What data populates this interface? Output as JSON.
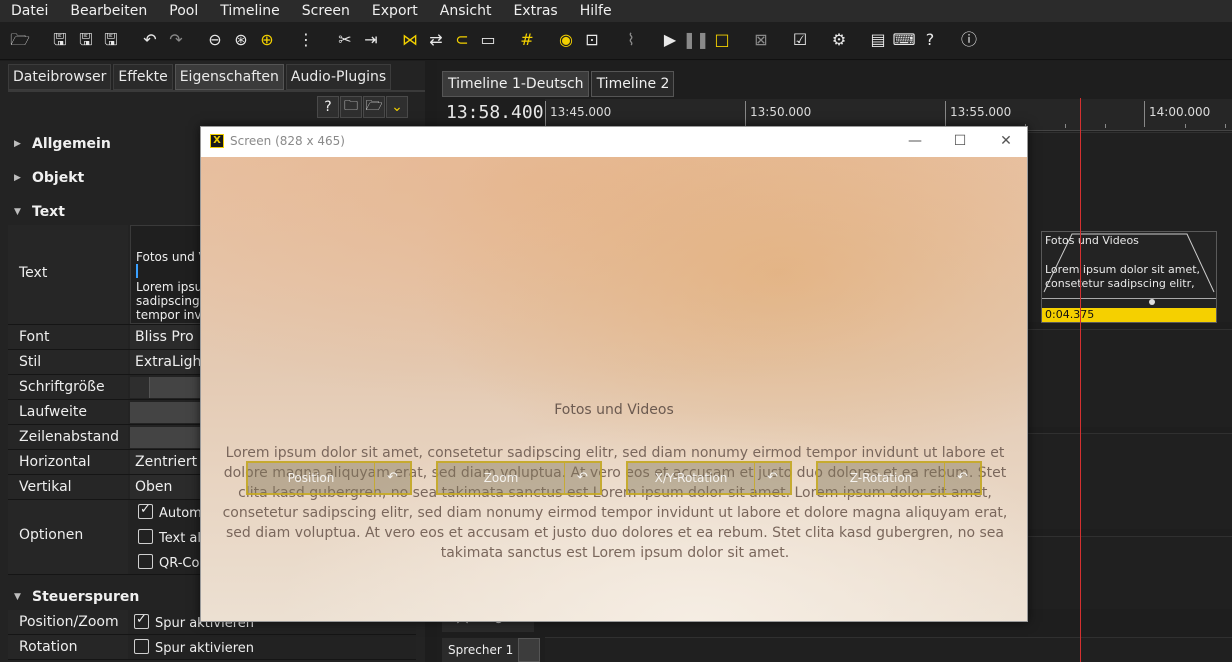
{
  "menu": [
    "Datei",
    "Bearbeiten",
    "Pool",
    "Timeline",
    "Screen",
    "Export",
    "Ansicht",
    "Extras",
    "Hilfe"
  ],
  "left_tabs": [
    "Dateibrowser",
    "Effekte",
    "Eigenschaften",
    "Audio-Plugins"
  ],
  "sections": {
    "allgemein": "Allgemein",
    "objekt": "Objekt",
    "text": "Text",
    "steuerspuren": "Steuerspuren"
  },
  "props": {
    "text_label": "Text",
    "text_line1": "Fotos und V",
    "text_line2": "Lorem ipsum",
    "text_line3": "sadipscing e",
    "text_line4": "tempor invi",
    "font_label": "Font",
    "font_value": "Bliss Pro",
    "stil_label": "Stil",
    "stil_value": "ExtraLight",
    "schriftgroesse_label": "Schriftgröße",
    "laufweite_label": "Laufweite",
    "zeilenabstand_label": "Zeilenabstand",
    "horizontal_label": "Horizontal",
    "horizontal_value": "Zentriert",
    "vertikal_label": "Vertikal",
    "vertikal_value": "Oben",
    "optionen_label": "Optionen",
    "opt1": "Automa",
    "opt2": "Text al",
    "opt3": "QR-Coc",
    "position_zoom_label": "Position/Zoom",
    "rotation_label": "Rotation",
    "spur_aktivieren": "Spur aktivieren"
  },
  "timeline": {
    "tabs": [
      "Timeline 1-Deutsch",
      "Timeline 2"
    ],
    "current_time": "13:58.400",
    "ruler": [
      "13:45.000",
      "13:50.000",
      "13:55.000",
      "14:00.000"
    ],
    "clip_title": "Fotos und Videos",
    "clip_text_1": "Lorem ipsum dolor sit amet,",
    "clip_text_2": "consetetur sadipscing elitr,",
    "clip_duration": "0:04.375",
    "speaker": "Sprecher 1"
  },
  "screen": {
    "title": "Screen (828 x 465)",
    "canvas_title": "Fotos und Videos",
    "canvas_body": "Lorem ipsum dolor sit amet, consetetur sadipscing elitr, sed diam nonumy eirmod tempor invidunt ut labore et dolore magna aliquyam erat, sed diam voluptua. At vero eos et accusam et justo duo dolores et ea rebum. Stet clita kasd gubergren, no sea takimata sanctus est Lorem ipsum dolor sit amet. Lorem ipsum dolor sit amet, consetetur sadipscing elitr, sed diam nonumy eirmod tempor invidunt ut labore et dolore magna aliquyam erat, sed diam voluptua. At vero eos et accusam et justo duo dolores et ea rebum. Stet clita kasd gubergren, no sea takimata sanctus est Lorem ipsum dolor sit amet.",
    "controls": [
      "Position",
      "Zoom",
      "X/Y-Rotation",
      "Z-Rotation"
    ]
  },
  "colors": {
    "accent": "#f2d000",
    "playhead": "#d43030"
  }
}
